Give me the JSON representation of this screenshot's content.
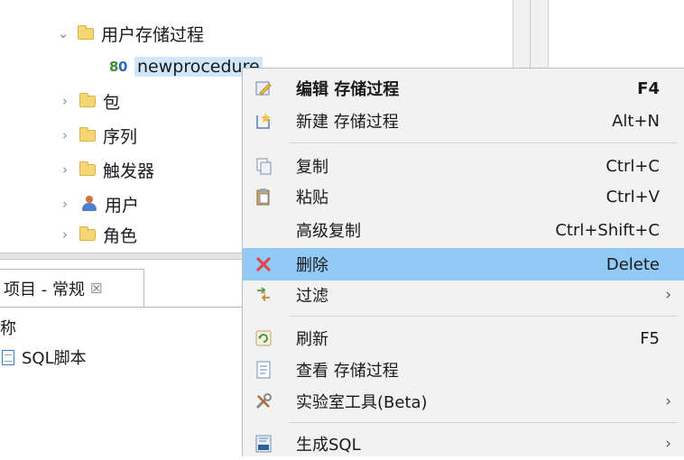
{
  "tree": {
    "stored_procs_folder": "用户存储过程",
    "procedure_item": "newprocedure",
    "package_folder": "包",
    "sequence_folder": "序列",
    "trigger_folder": "触发器",
    "user_folder": "用户",
    "role_folder": "角色"
  },
  "bottom_panel": {
    "tab_label": "项目 - 常规",
    "tab_close": "☒",
    "name_fragment": "称",
    "sql_script_item": "SQL脚本"
  },
  "menu": {
    "items": [
      {
        "label": "编辑 存储过程",
        "accel": "F4",
        "icon": "edit-icon"
      },
      {
        "label": "新建 存储过程",
        "accel": "Alt+N",
        "icon": "new-icon"
      },
      {
        "label": "复制",
        "accel": "Ctrl+C",
        "icon": "copy-icon"
      },
      {
        "label": "粘贴",
        "accel": "Ctrl+V",
        "icon": "paste-icon"
      },
      {
        "label": "高级复制",
        "accel": "Ctrl+Shift+C",
        "icon": ""
      },
      {
        "label": "删除",
        "accel": "Delete",
        "icon": "delete-icon"
      },
      {
        "label": "过滤",
        "accel": "",
        "icon": "filter-icon",
        "submenu": "›"
      },
      {
        "label": "刷新",
        "accel": "F5",
        "icon": "refresh-icon"
      },
      {
        "label": "查看 存储过程",
        "accel": "",
        "icon": "view-icon"
      },
      {
        "label": "实验室工具(Beta)",
        "accel": "",
        "icon": "tools-icon",
        "submenu": "›"
      },
      {
        "label": "生成SQL",
        "accel": "",
        "icon": "sql-icon",
        "submenu": "›"
      }
    ]
  },
  "colors": {
    "menu_bg": "#f2f2f2",
    "highlight": "#91c9f7",
    "selection": "#cfe6fb",
    "delete_icon": "#e0474c"
  }
}
